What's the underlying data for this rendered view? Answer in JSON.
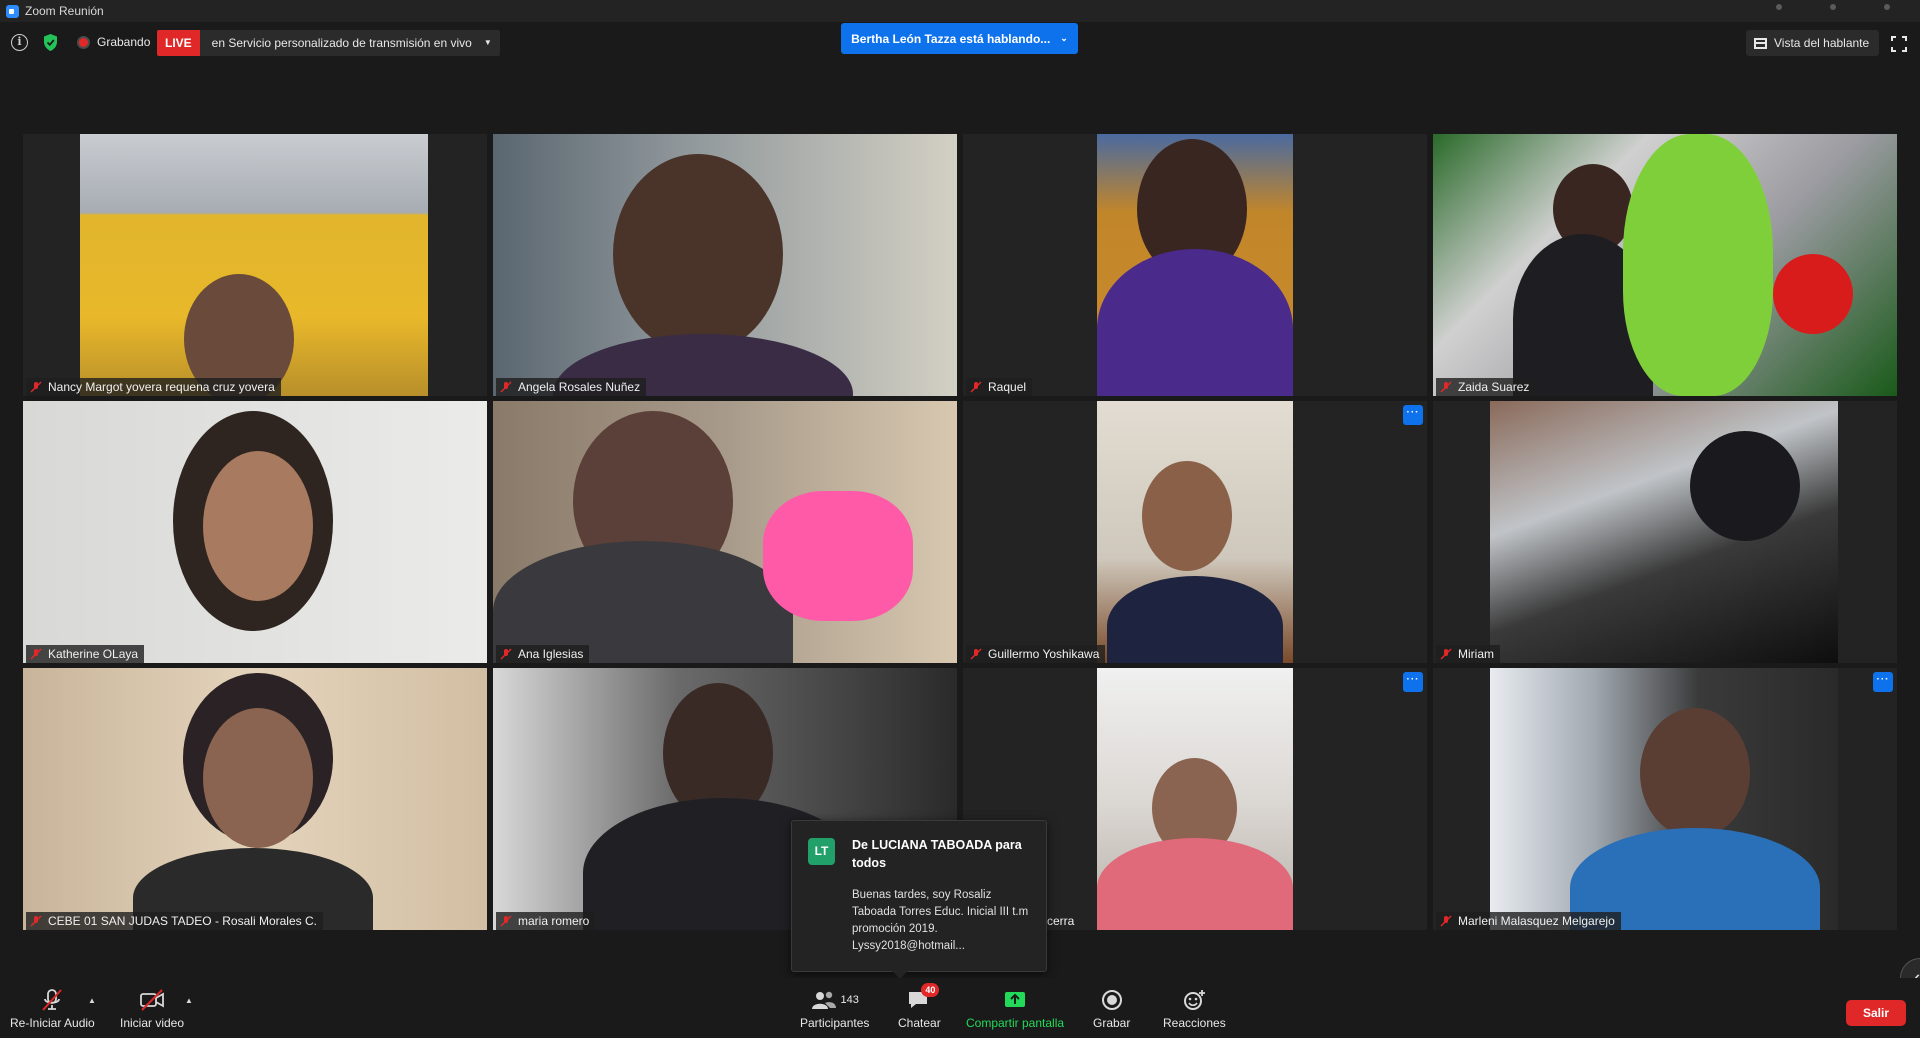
{
  "window": {
    "title": "Zoom Reunión"
  },
  "topbar": {
    "recording_label": "Grabando",
    "live_badge": "LIVE",
    "live_service": "en Servicio personalizado de transmisión en vivo",
    "active_speaker": "Bertha León Tazza está hablando...",
    "view_label": "Vista del hablante"
  },
  "participants_grid": [
    {
      "name": "Nancy Margot yovera requena cruz yovera",
      "muted": true,
      "has_more_menu": false
    },
    {
      "name": "Angela Rosales Nuñez",
      "muted": true,
      "has_more_menu": false
    },
    {
      "name": "Raquel",
      "muted": true,
      "has_more_menu": false
    },
    {
      "name": "Zaida Suarez",
      "muted": true,
      "has_more_menu": false
    },
    {
      "name": "Katherine OLaya",
      "muted": true,
      "has_more_menu": false
    },
    {
      "name": "Ana Iglesias",
      "muted": true,
      "has_more_menu": false
    },
    {
      "name": "Guillermo Yoshikawa",
      "muted": true,
      "has_more_menu": true
    },
    {
      "name": "Miriam",
      "muted": true,
      "has_more_menu": false
    },
    {
      "name": "CEBE 01 SAN JUDAS TADEO - Rosali Morales C.",
      "muted": true,
      "has_more_menu": false
    },
    {
      "name": "maria romero",
      "muted": true,
      "has_more_menu": false
    },
    {
      "name": "cerra",
      "muted": false,
      "has_more_menu": true
    },
    {
      "name": "Marleni Malasquez Melgarejo",
      "muted": true,
      "has_more_menu": true
    }
  ],
  "chat_popup": {
    "avatar_initials": "LT",
    "from": "De LUCIANA TABOADA para todos",
    "message": "Buenas tardes, soy Rosaliz Taboada Torres Educ. Inicial III t.m promoción 2019. Lyssy2018@hotmail..."
  },
  "toolbar": {
    "audio_label": "Re-Iniciar Audio",
    "video_label": "Iniciar video",
    "participants_label": "Participantes",
    "participants_count": "143",
    "chat_label": "Chatear",
    "chat_badge": "40",
    "share_label": "Compartir pantalla",
    "record_label": "Grabar",
    "reactions_label": "Reacciones",
    "exit_label": "Salir"
  },
  "colors": {
    "accent_blue": "#0e72ed",
    "live_red": "#e02828",
    "share_green": "#23d959",
    "background": "#1a1a1a"
  }
}
